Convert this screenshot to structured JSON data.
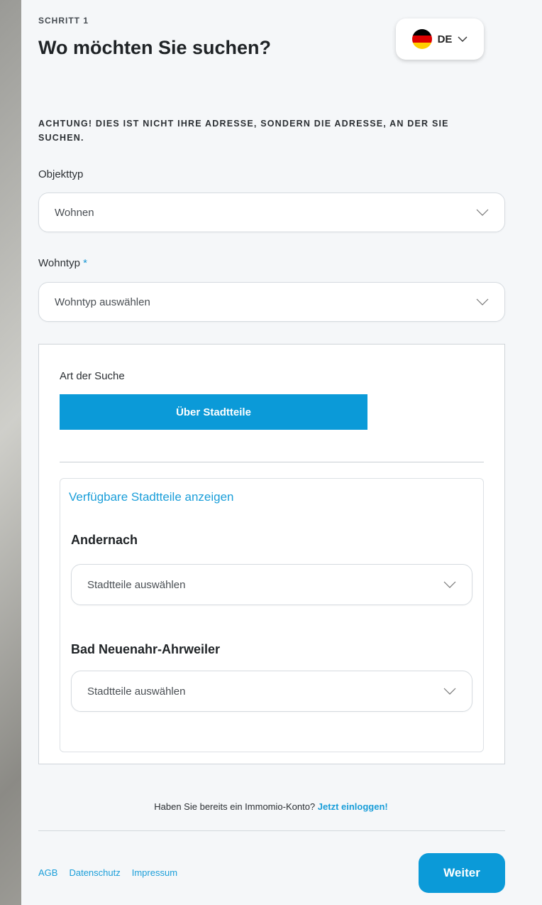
{
  "header": {
    "step": "SCHRITT 1",
    "title": "Wo möchten Sie suchen?",
    "language": {
      "code": "DE",
      "flag_colors": [
        "#000000",
        "#dd0000",
        "#ffce00"
      ]
    }
  },
  "warning": "ACHTUNG! DIES IST NICHT IHRE ADRESSE, SONDERN DIE ADRESSE, AN DER SIE SUCHEN.",
  "object_type": {
    "label": "Objekttyp",
    "value": "Wohnen"
  },
  "residence_type": {
    "label": "Wohntyp",
    "required_mark": "*",
    "placeholder": "Wohntyp auswählen"
  },
  "search": {
    "label": "Art der Suche",
    "mode_button": "Über Stadtteile",
    "show_districts_link": "Verfügbare Stadtteile anzeigen",
    "cities": [
      {
        "name": "Andernach",
        "placeholder": "Stadtteile auswählen"
      },
      {
        "name": "Bad Neuenahr-Ahrweiler",
        "placeholder": "Stadtteile auswählen"
      }
    ]
  },
  "login": {
    "text": "Haben Sie bereits ein Immomio-Konto?",
    "link": "Jetzt einloggen!"
  },
  "footer": {
    "links": [
      "AGB",
      "Datenschutz",
      "Impressum"
    ],
    "next_button": "Weiter"
  },
  "colors": {
    "accent": "#0b9ad8",
    "link": "#1a9ed9",
    "panel_bg": "#f5f7f9"
  }
}
